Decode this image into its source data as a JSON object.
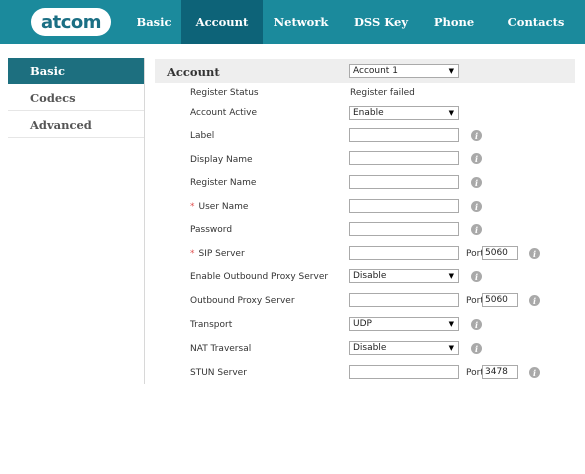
{
  "brand": {
    "logo": "atcom"
  },
  "nav": {
    "tabs": [
      {
        "label": "Basic"
      },
      {
        "label": "Account"
      },
      {
        "label": "Network"
      },
      {
        "label": "DSS Key"
      },
      {
        "label": "Phone"
      },
      {
        "label": "Contacts"
      }
    ],
    "active": "Account"
  },
  "sidebar": {
    "items": [
      {
        "label": "Basic"
      },
      {
        "label": "Codecs"
      },
      {
        "label": "Advanced"
      }
    ],
    "active": "Basic"
  },
  "section": {
    "title": "Account",
    "account_select": "Account 1"
  },
  "form": {
    "register_status": {
      "label": "Register Status",
      "value": "Register failed"
    },
    "account_active": {
      "label": "Account Active",
      "value": "Enable"
    },
    "label": {
      "label": "Label",
      "value": ""
    },
    "display_name": {
      "label": "Display Name",
      "value": ""
    },
    "register_name": {
      "label": "Register Name",
      "value": ""
    },
    "user_name": {
      "label": "User Name",
      "required": "*",
      "value": ""
    },
    "password": {
      "label": "Password",
      "value": ""
    },
    "sip_server": {
      "label": "SIP Server",
      "required": "*",
      "value": "",
      "port_label": "Port",
      "port": "5060"
    },
    "enable_outbound_proxy": {
      "label": "Enable Outbound Proxy Server",
      "value": "Disable"
    },
    "outbound_proxy": {
      "label": "Outbound Proxy Server",
      "value": "",
      "port_label": "Port",
      "port": "5060"
    },
    "transport": {
      "label": "Transport",
      "value": "UDP"
    },
    "nat_traversal": {
      "label": "NAT Traversal",
      "value": "Disable"
    },
    "stun_server": {
      "label": "STUN Server",
      "value": "",
      "port_label": "Port",
      "port": "3478"
    }
  },
  "icons": {
    "info": "i",
    "dropdown": "▼"
  },
  "colors": {
    "topbar": "#1b8a9c",
    "active_tab": "#0d6378",
    "sidebar_active": "#1d6f7f"
  }
}
